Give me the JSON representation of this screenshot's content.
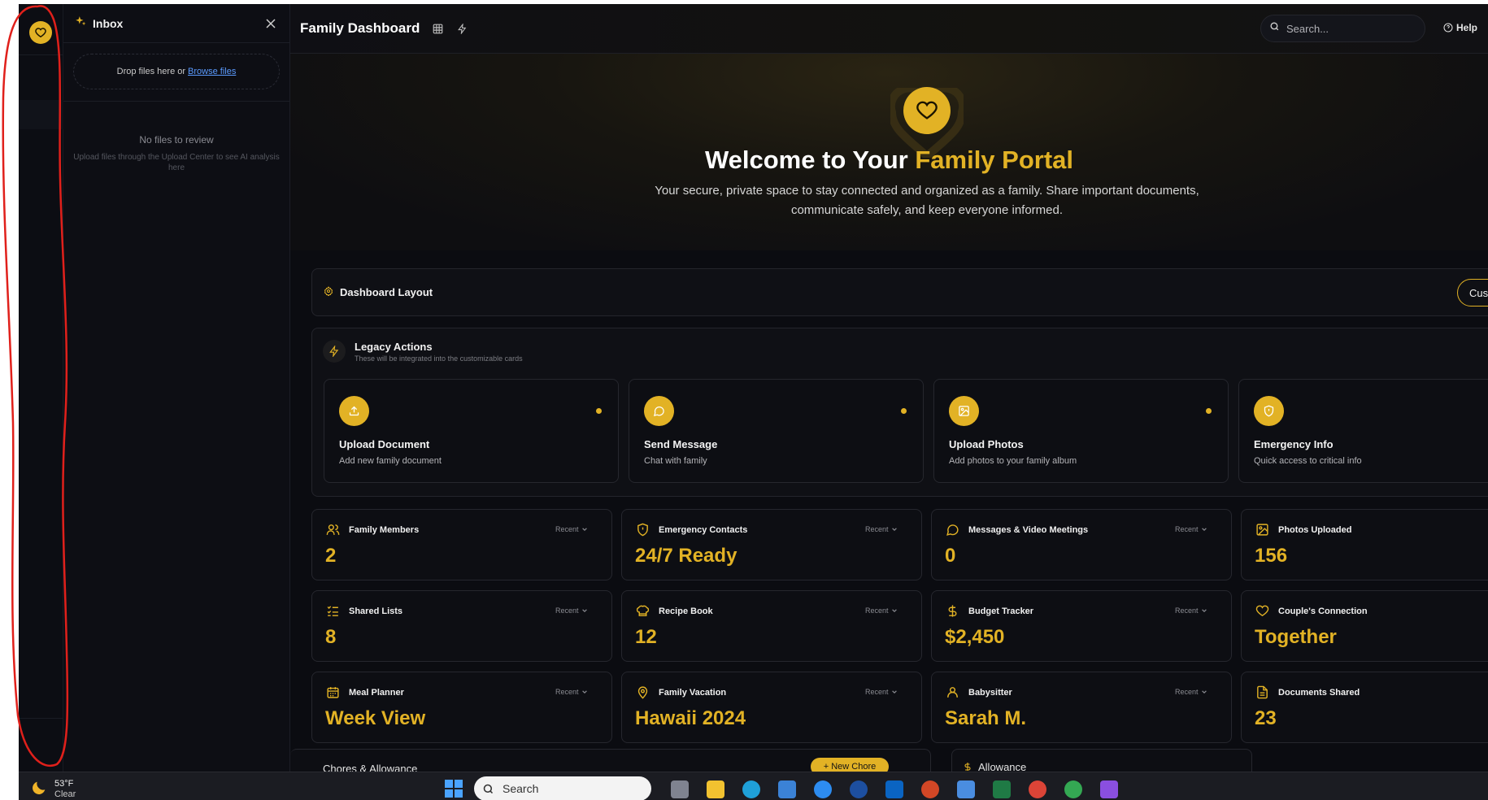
{
  "inbox": {
    "title": "Inbox",
    "drop_text": "Drop files here or",
    "browse_link": "Browse files",
    "empty_title": "No files to review",
    "empty_sub": "Upload files through the Upload Center to see AI analysis here"
  },
  "header": {
    "title": "Family Dashboard",
    "search_placeholder": "Search...",
    "help_label": "Help"
  },
  "hero": {
    "title_plain": "Welcome to Your ",
    "title_accent": "Family Portal",
    "subtitle": "Your secure, private space to stay connected and organized as a family. Share important documents, communicate safely, and keep everyone informed."
  },
  "layout_bar": {
    "title": "Dashboard Layout",
    "customize_label": "Cus"
  },
  "legacy": {
    "title": "Legacy Actions",
    "subtitle": "These will be integrated into the customizable cards",
    "actions": [
      {
        "title": "Upload Document",
        "sub": "Add new family document",
        "icon": "upload-icon"
      },
      {
        "title": "Send Message",
        "sub": "Chat with family",
        "icon": "message-icon"
      },
      {
        "title": "Upload Photos",
        "sub": "Add photos to your family album",
        "icon": "image-icon"
      },
      {
        "title": "Emergency Info",
        "sub": "Quick access to critical info",
        "icon": "shield-icon"
      }
    ]
  },
  "stats": {
    "recent_label": "Recent",
    "cards": [
      {
        "label": "Family Members",
        "value": "2",
        "icon": "users-icon"
      },
      {
        "label": "Emergency Contacts",
        "value": "24/7 Ready",
        "icon": "shield-alert-icon"
      },
      {
        "label": "Messages & Video Meetings",
        "value": "0",
        "icon": "message-icon"
      },
      {
        "label": "Photos Uploaded",
        "value": "156",
        "icon": "image-icon"
      },
      {
        "label": "Shared Lists",
        "value": "8",
        "icon": "list-icon"
      },
      {
        "label": "Recipe Book",
        "value": "12",
        "icon": "chef-hat-icon"
      },
      {
        "label": "Budget Tracker",
        "value": "$2,450",
        "icon": "dollar-icon"
      },
      {
        "label": "Couple's Connection",
        "value": "Together",
        "icon": "heart-icon"
      },
      {
        "label": "Meal Planner",
        "value": "Week View",
        "icon": "calendar-icon"
      },
      {
        "label": "Family Vacation",
        "value": "Hawaii 2024",
        "icon": "map-pin-icon"
      },
      {
        "label": "Babysitter",
        "value": "Sarah M.",
        "icon": "user-icon"
      },
      {
        "label": "Documents Shared",
        "value": "23",
        "icon": "file-icon"
      }
    ]
  },
  "bottom": {
    "chores_title": "Chores & Allowance",
    "new_chore": "New Chore",
    "allowance_title": "Allowance"
  },
  "taskbar": {
    "temp": "53°F",
    "condition": "Clear",
    "search_label": "Search"
  },
  "colors": {
    "accent": "#e2b225",
    "annotation": "#e0201b"
  }
}
